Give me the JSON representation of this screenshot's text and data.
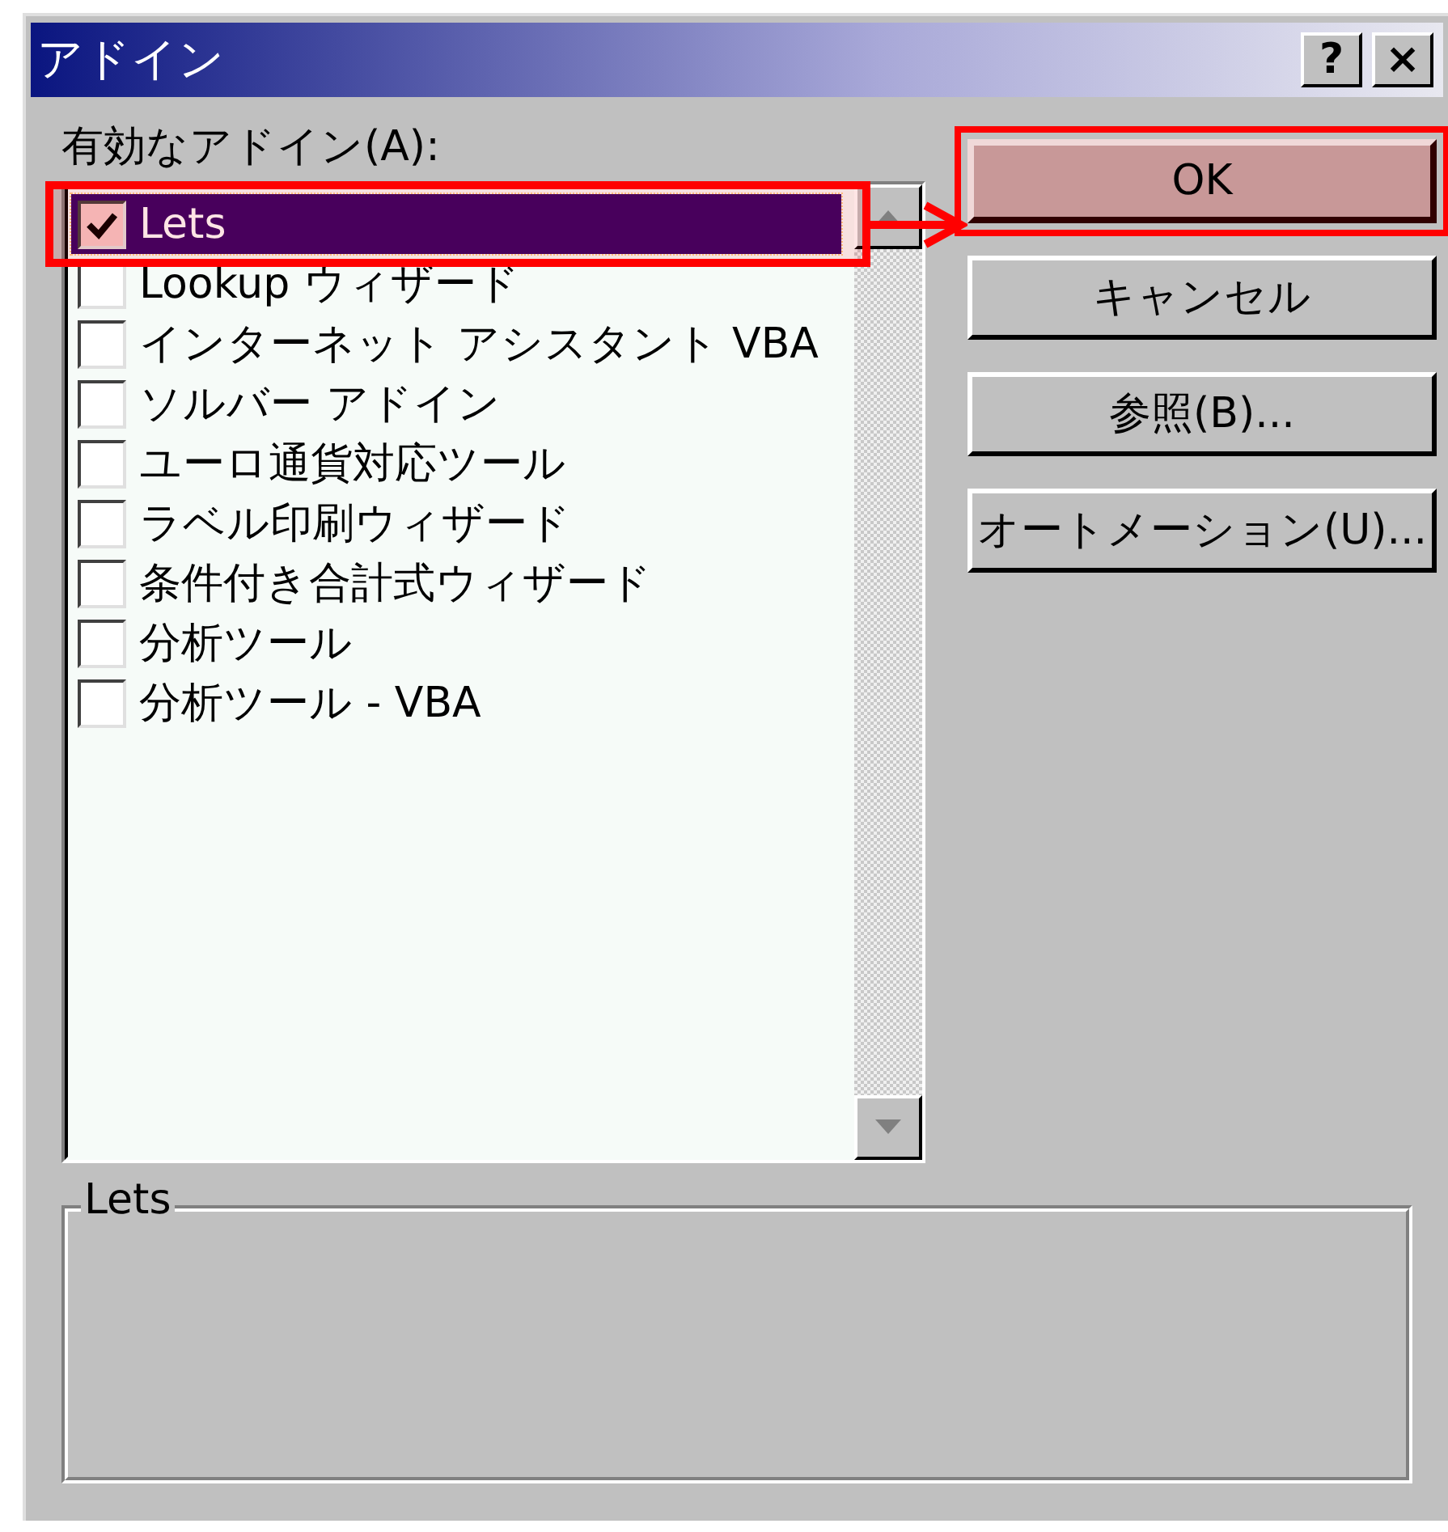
{
  "window": {
    "title": "アドイン",
    "title_buttons": [
      "?",
      "×"
    ]
  },
  "list_label": "有効なアドイン(A):",
  "addins": [
    {
      "label": "Lets",
      "checked": true,
      "selected": true
    },
    {
      "label": "Lookup ウィザード",
      "checked": false,
      "selected": false
    },
    {
      "label": "インターネット アシスタント VBA",
      "checked": false,
      "selected": false
    },
    {
      "label": "ソルバー アドイン",
      "checked": false,
      "selected": false
    },
    {
      "label": "ユーロ通貨対応ツール",
      "checked": false,
      "selected": false
    },
    {
      "label": "ラベル印刷ウィザード",
      "checked": false,
      "selected": false
    },
    {
      "label": "条件付き合計式ウィザード",
      "checked": false,
      "selected": false
    },
    {
      "label": "分析ツール",
      "checked": false,
      "selected": false
    },
    {
      "label": "分析ツール - VBA",
      "checked": false,
      "selected": false
    }
  ],
  "buttons": [
    {
      "label": "OK",
      "default": true
    },
    {
      "label": "キャンセル",
      "default": false
    },
    {
      "label": "参照(B)...",
      "default": false
    },
    {
      "label": "オートメーション(U)...",
      "default": false
    }
  ],
  "description_group": {
    "title": "Lets"
  }
}
